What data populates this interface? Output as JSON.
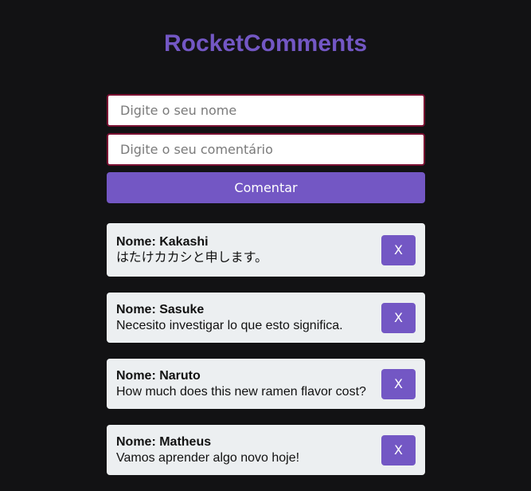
{
  "app": {
    "title": "RocketComments"
  },
  "form": {
    "name_placeholder": "Digite o seu nome",
    "comment_placeholder": "Digite o seu comentário",
    "submit_label": "Comentar"
  },
  "comments": [
    {
      "name_line": "Nome: Kakashi",
      "text": "はたけカカシと申します。",
      "delete_label": "X"
    },
    {
      "name_line": "Nome: Sasuke",
      "text": "Necesito investigar lo que esto significa.",
      "delete_label": "X"
    },
    {
      "name_line": "Nome: Naruto",
      "text": "How much does this new ramen flavor cost?",
      "delete_label": "X"
    },
    {
      "name_line": "Nome: Matheus",
      "text": "Vamos aprender algo novo hoje!",
      "delete_label": "X"
    }
  ],
  "colors": {
    "background": "#121214",
    "accent": "#7357c4",
    "input_border": "#7a1032",
    "card": "#eceff1"
  }
}
